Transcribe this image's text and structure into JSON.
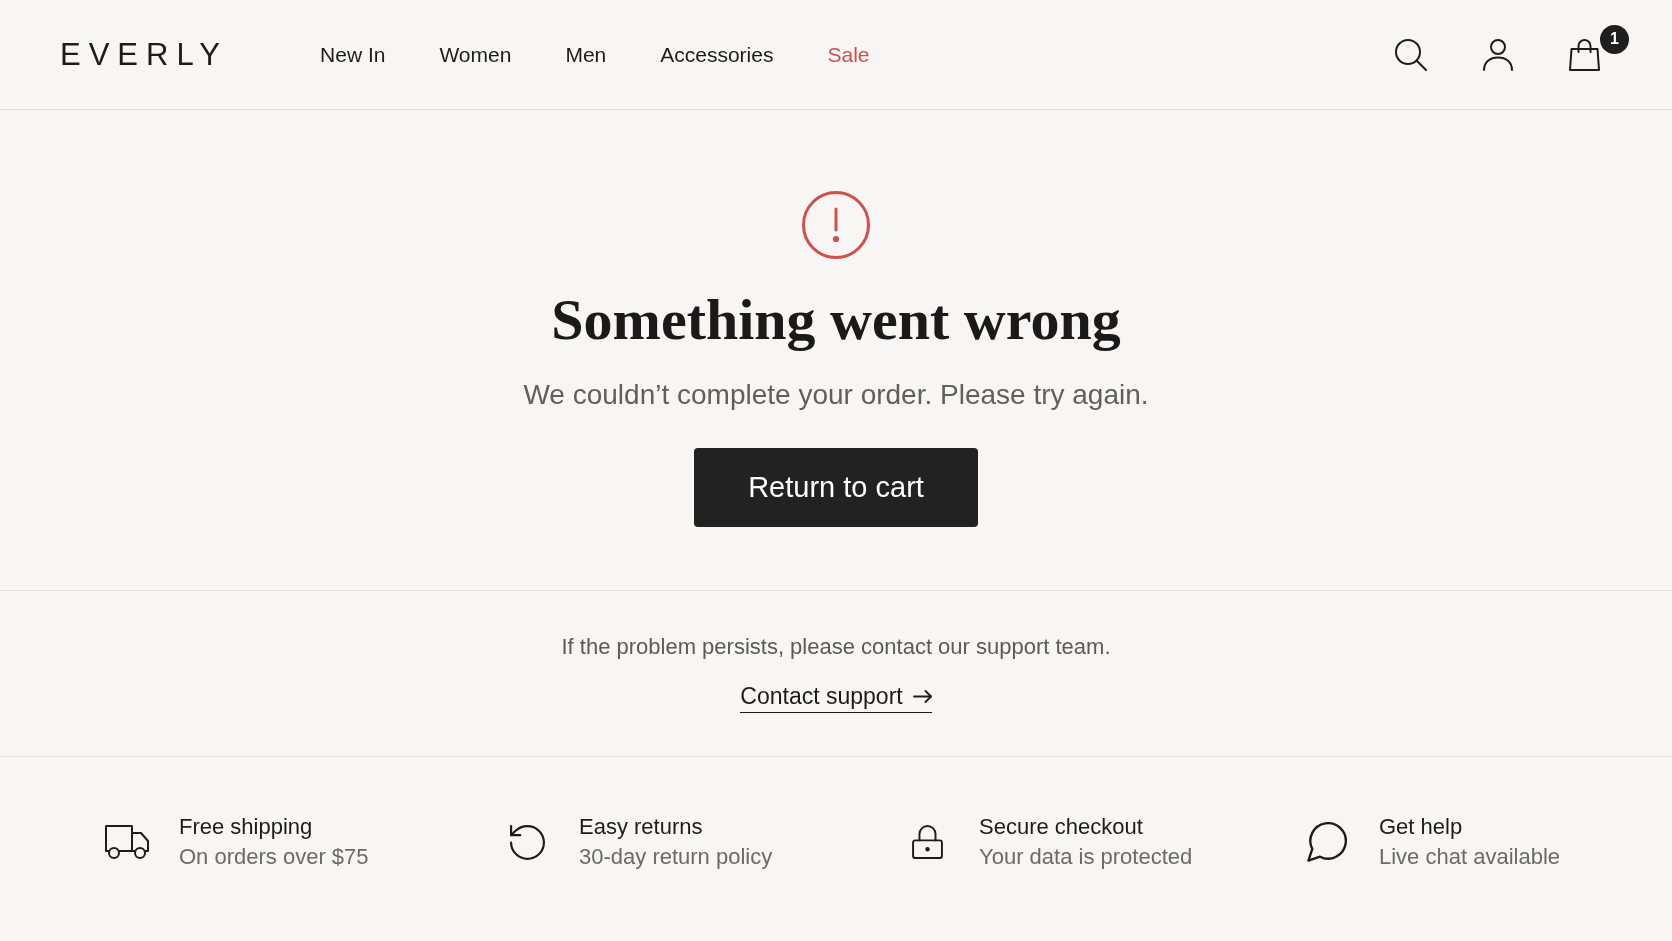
{
  "header": {
    "logo": "EVERLY",
    "nav": [
      {
        "label": "New In",
        "kind": "link"
      },
      {
        "label": "Women",
        "kind": "link"
      },
      {
        "label": "Men",
        "kind": "link"
      },
      {
        "label": "Accessories",
        "kind": "link"
      },
      {
        "label": "Sale",
        "kind": "sale"
      }
    ],
    "cart_count": "1"
  },
  "error": {
    "title": "Something went wrong",
    "message": "We couldn’t complete your order. Please try again.",
    "button": "Return to cart"
  },
  "support": {
    "text": "If the problem persists, please contact our support team.",
    "link": "Contact support"
  },
  "features": [
    {
      "kind": "shipping",
      "title": "Free shipping",
      "subtitle": "On orders over $75"
    },
    {
      "kind": "returns",
      "title": "Easy returns",
      "subtitle": "30-day return policy"
    },
    {
      "kind": "secure",
      "title": "Secure checkout",
      "subtitle": "Your data is protected"
    },
    {
      "kind": "help",
      "title": "Get help",
      "subtitle": "Live chat available"
    }
  ]
}
